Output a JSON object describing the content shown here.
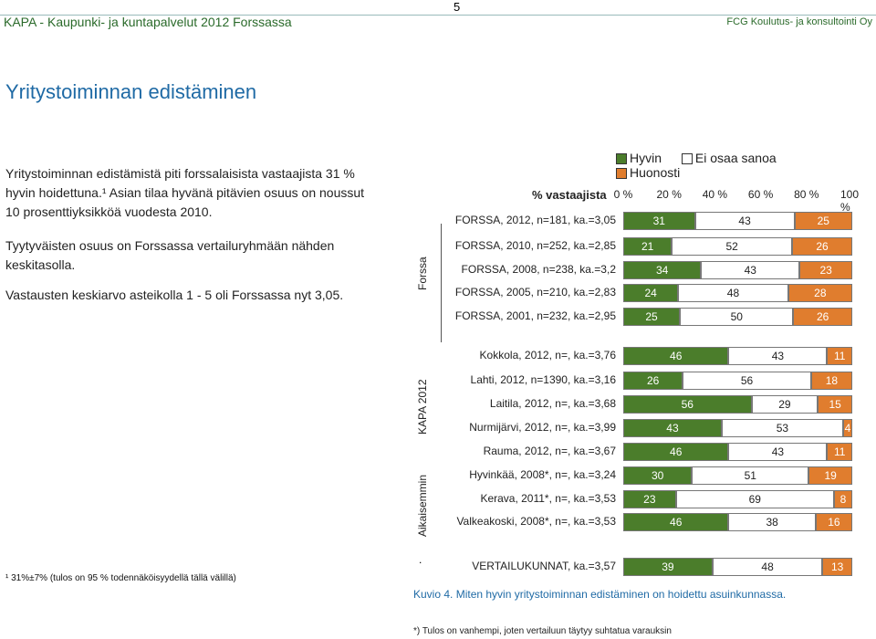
{
  "header": {
    "page_number": "5",
    "left_title": "KAPA - Kaupunki- ja kuntapalvelut 2012 Forssassa",
    "right_title": "FCG Koulutus- ja konsultointi Oy"
  },
  "title": "Yritystoiminnan edistäminen",
  "paragraphs": [
    "Yritystoiminnan edistämistä piti forssalaisista vastaajista 31 % hyvin hoidettuna.¹ Asian tilaa hyvänä pitävien osuus on noussut 10 prosenttiyksikköä vuodesta 2010.",
    "Tyytyväisten osuus on Forssassa vertailuryhmään nähden keskitasolla.",
    "Vastausten keskiarvo asteikolla 1 - 5 oli Forssassa nyt 3,05."
  ],
  "footnote_left": "¹ 31%±7% (tulos on 95 % todennäköisyydellä tällä välillä)",
  "chart_data": {
    "type": "bar",
    "stacked": true,
    "orientation": "horizontal",
    "axis_title": "% vastaajista",
    "ticks": [
      "0 %",
      "20 %",
      "40 %",
      "60 %",
      "80 %",
      "100 %"
    ],
    "xlim": [
      0,
      100
    ],
    "legend": [
      {
        "name": "Hyvin",
        "color": "#4b7d2b"
      },
      {
        "name": "Ei osaa sanoa",
        "color": "#ffffff"
      },
      {
        "name": "Huonosti",
        "color": "#e07d2e"
      }
    ],
    "groups": [
      {
        "label": "Forssa"
      },
      {
        "label": "KAPA 2012"
      },
      {
        "label": "Aikaisemmin"
      }
    ],
    "rows": [
      {
        "label": "FORSSA, 2012, n=181, ka.=3,05",
        "values": [
          31,
          43,
          25
        ]
      },
      {
        "label": "FORSSA, 2010, n=252, ka.=2,85",
        "values": [
          21,
          52,
          26
        ]
      },
      {
        "label": "FORSSA, 2008, n=238, ka.=3,2",
        "values": [
          34,
          43,
          23
        ]
      },
      {
        "label": "FORSSA, 2005, n=210, ka.=2,83",
        "values": [
          24,
          48,
          28
        ]
      },
      {
        "label": "FORSSA, 2001, n=232, ka.=2,95",
        "values": [
          25,
          50,
          26
        ]
      },
      {
        "label": "Kokkola, 2012, n=, ka.=3,76",
        "values": [
          46,
          43,
          11
        ]
      },
      {
        "label": "Lahti, 2012, n=1390, ka.=3,16",
        "values": [
          26,
          56,
          18
        ]
      },
      {
        "label": "Laitila, 2012, n=, ka.=3,68",
        "values": [
          56,
          29,
          15
        ]
      },
      {
        "label": "Nurmijärvi, 2012, n=, ka.=3,99",
        "values": [
          43,
          53,
          4
        ]
      },
      {
        "label": "Rauma, 2012, n=, ka.=3,67",
        "values": [
          46,
          43,
          11
        ]
      },
      {
        "label": "Hyvinkää, 2008*, n=, ka.=3,24",
        "values": [
          30,
          51,
          19
        ]
      },
      {
        "label": "Kerava, 2011*, n=, ka.=3,53",
        "values": [
          23,
          69,
          8
        ]
      },
      {
        "label": "Valkeakoski, 2008*, n=, ka.=3,53",
        "values": [
          46,
          38,
          16
        ]
      },
      {
        "label": "VERTAILUKUNNAT, ka.=3,57",
        "values": [
          39,
          48,
          13
        ]
      }
    ]
  },
  "caption": "Kuvio 4. Miten hyvin yritystoiminnan edistäminen on hoidettu asuinkunnassa.",
  "footnote_bottom": "*) Tulos on vanhempi, joten vertailuun täytyy suhtatua varauksin",
  "dot": "."
}
